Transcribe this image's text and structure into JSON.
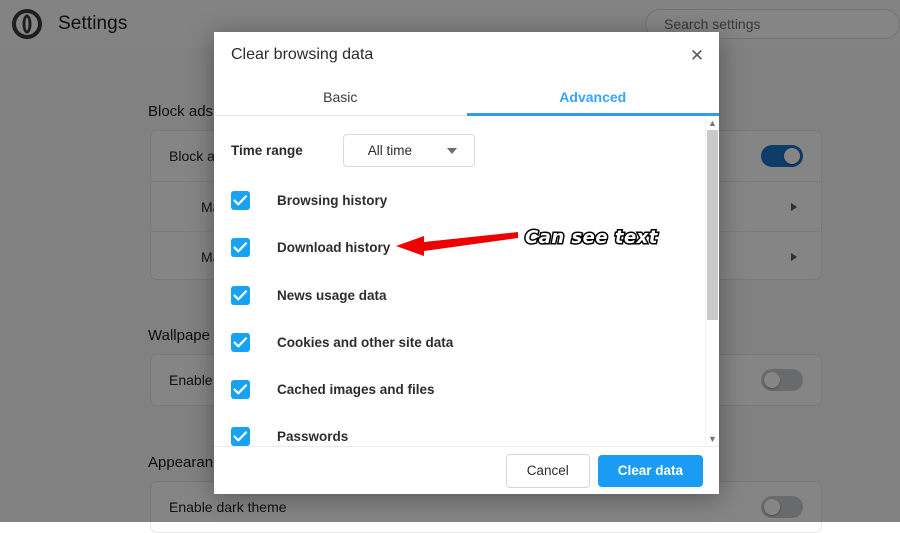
{
  "background": {
    "app_title": "Settings",
    "logo_icon": "opera-logo-icon",
    "search": {
      "placeholder": "Search settings",
      "icon": "search-icon"
    },
    "sections": [
      {
        "title": "Block ads",
        "rows": [
          {
            "label": "Block a",
            "control": "toggle",
            "state": "on"
          },
          {
            "label": "Man",
            "control": "chevron"
          },
          {
            "label": "Man",
            "control": "chevron"
          }
        ]
      },
      {
        "title": "Wallpape",
        "rows": [
          {
            "label": "Enable",
            "control": "toggle",
            "state": "off"
          }
        ]
      },
      {
        "title": "Appearan",
        "rows": [
          {
            "label": "Enable dark theme",
            "control": "toggle",
            "state": "off"
          }
        ]
      }
    ]
  },
  "dialog": {
    "title": "Clear browsing data",
    "close_icon": "close-icon",
    "tabs": [
      {
        "label": "Basic",
        "active": false
      },
      {
        "label": "Advanced",
        "active": true
      }
    ],
    "time_range": {
      "label": "Time range",
      "value": "All time",
      "caret_icon": "chevron-down-icon"
    },
    "items": [
      {
        "label": "Browsing history",
        "checked": true
      },
      {
        "label": "Download history",
        "checked": true
      },
      {
        "label": "News usage data",
        "checked": true
      },
      {
        "label": "Cookies and other site data",
        "checked": true
      },
      {
        "label": "Cached images and files",
        "checked": true
      },
      {
        "label": "Passwords",
        "checked": true
      }
    ],
    "scrollbar": {
      "up_icon": "chevron-up-icon",
      "down_icon": "chevron-down-icon"
    },
    "footer": {
      "cancel_label": "Cancel",
      "confirm_label": "Clear data"
    }
  },
  "annotation": {
    "text": "Can see text",
    "arrow_icon": "left-arrow-icon",
    "color": "#ee0000"
  },
  "colors": {
    "accent_blue": "#1a9cf5",
    "tab_active": "#36a5ff",
    "checkbox_blue": "#17a2f3",
    "toggle_on": "#1a73c7",
    "annotation_red": "#ee0000"
  }
}
